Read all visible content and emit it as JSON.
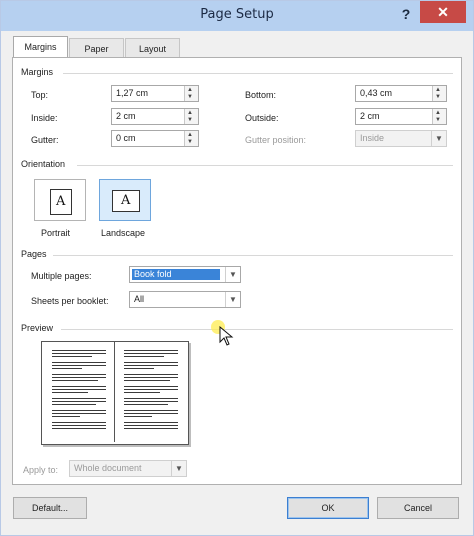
{
  "window": {
    "title": "Page Setup",
    "help_label": "?",
    "close_label": "✕"
  },
  "tabs": [
    {
      "label": "Margins",
      "active": true
    },
    {
      "label": "Paper",
      "active": false
    },
    {
      "label": "Layout",
      "active": false
    }
  ],
  "margins": {
    "heading": "Margins",
    "top": {
      "label": "Top:",
      "value": "1,27 cm"
    },
    "bottom": {
      "label": "Bottom:",
      "value": "0,43 cm"
    },
    "inside": {
      "label": "Inside:",
      "value": "2 cm"
    },
    "outside": {
      "label": "Outside:",
      "value": "2 cm"
    },
    "gutter": {
      "label": "Gutter:",
      "value": "0 cm"
    },
    "gutter_position": {
      "label": "Gutter position:",
      "value": "Inside",
      "enabled": false
    }
  },
  "orientation": {
    "heading": "Orientation",
    "portrait": {
      "label": "Portrait",
      "glyph": "A",
      "selected": false
    },
    "landscape": {
      "label": "Landscape",
      "glyph": "A",
      "selected": true
    }
  },
  "pages": {
    "heading": "Pages",
    "multiple_pages": {
      "label": "Multiple pages:",
      "value": "Book fold"
    },
    "sheets_per_booklet": {
      "label": "Sheets per booklet:",
      "value": "All"
    }
  },
  "preview": {
    "heading": "Preview",
    "apply_to": {
      "label": "Apply to:",
      "value": "Whole document",
      "enabled": false
    }
  },
  "buttons": {
    "default": "Default...",
    "ok": "OK",
    "cancel": "Cancel"
  },
  "icons": {
    "help": "help-icon",
    "close": "close-icon",
    "spin": "spin-arrows-icon",
    "dropdown": "chevron-down-icon",
    "cursor": "mouse-pointer-icon"
  },
  "colors": {
    "titlebar": "#b6d0f0",
    "close": "#c74a46",
    "selection": "#3a84d8",
    "accent_border": "#3c7fd1"
  }
}
